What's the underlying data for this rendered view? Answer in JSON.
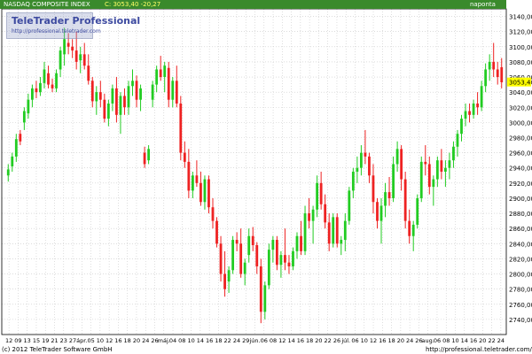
{
  "header": {
    "title": "NASDAQ COMPOSITE INDEX",
    "quote": "C: 3053,40 -20,27",
    "period": "napontа"
  },
  "watermark": {
    "title": "TeleTrader Professional",
    "url": "http://professional.teletrader.com"
  },
  "footer": {
    "copyright": "(c) 2012 TeleTrader Software GmbH",
    "url": "http://professional.teletrader.com/"
  },
  "colors": {
    "up": "#22cc22",
    "down": "#ee2222",
    "grid": "#c8c8c8",
    "header_bg": "#3a8a2c",
    "last_price_bg": "#ffff00"
  },
  "chart_data": {
    "type": "candlestick",
    "title": "NASDAQ COMPOSITE INDEX",
    "last_price": "3053,40",
    "change": "-20,27",
    "ylim": [
      2720,
      3150
    ],
    "y_ticks": [
      "2740,00",
      "2760,00",
      "2780,00",
      "2800,00",
      "2820,00",
      "2840,00",
      "2860,00",
      "2880,00",
      "2900,00",
      "2920,00",
      "2940,00",
      "2960,00",
      "2980,00",
      "3000,00",
      "3020,00",
      "3040,00",
      "3060,00",
      "3080,00",
      "3100,00",
      "3120,00",
      "3140,00"
    ],
    "x_ticks": [
      "12",
      "09",
      "13",
      "15",
      "19",
      "21",
      "23",
      "27",
      "ápr.",
      "05",
      "10",
      "12",
      "16",
      "18",
      "20",
      "24",
      "26",
      "máj.",
      "04",
      "08",
      "10",
      "14",
      "16",
      "18",
      "22",
      "24",
      "29",
      "jún.",
      "06",
      "08",
      "12",
      "14",
      "16",
      "18",
      "20",
      "22",
      "26",
      "júl.",
      "06",
      "10",
      "12",
      "16",
      "18",
      "20",
      "24",
      "26",
      "aug.",
      "06",
      "08",
      "10",
      "14",
      "16",
      "20",
      "22",
      "24"
    ],
    "candles": [
      [
        2930,
        2945,
        2922,
        2938
      ],
      [
        2942,
        2960,
        2935,
        2955
      ],
      [
        2955,
        2985,
        2948,
        2978
      ],
      [
        2985,
        2990,
        2970,
        2975
      ],
      [
        3000,
        3020,
        2990,
        3015
      ],
      [
        3012,
        3038,
        3005,
        3030
      ],
      [
        3030,
        3050,
        3020,
        3045
      ],
      [
        3045,
        3055,
        3032,
        3040
      ],
      [
        3040,
        3060,
        3035,
        3052
      ],
      [
        3052,
        3080,
        3045,
        3070
      ],
      [
        3065,
        3075,
        3045,
        3050
      ],
      [
        3050,
        3058,
        3040,
        3045
      ],
      [
        3045,
        3070,
        3040,
        3065
      ],
      [
        3070,
        3100,
        3060,
        3095
      ],
      [
        3090,
        3125,
        3075,
        3110
      ],
      [
        3105,
        3118,
        3090,
        3100
      ],
      [
        3100,
        3110,
        3085,
        3095
      ],
      [
        3095,
        3120,
        3070,
        3080
      ],
      [
        3082,
        3100,
        3065,
        3090
      ],
      [
        3090,
        3105,
        3070,
        3075
      ],
      [
        3075,
        3090,
        3050,
        3055
      ],
      [
        3055,
        3060,
        3020,
        3028
      ],
      [
        3028,
        3048,
        3010,
        3040
      ],
      [
        3040,
        3055,
        3020,
        3030
      ],
      [
        3030,
        3038,
        3000,
        3005
      ],
      [
        3005,
        3030,
        2995,
        3025
      ],
      [
        3025,
        3050,
        3015,
        3045
      ],
      [
        3045,
        3060,
        3000,
        3010
      ],
      [
        3010,
        3040,
        2985,
        3035
      ],
      [
        3035,
        3045,
        3010,
        3020
      ],
      [
        3020,
        3055,
        3010,
        3048
      ],
      [
        3048,
        3070,
        3035,
        3055
      ],
      [
        3055,
        3062,
        3020,
        3030
      ],
      [
        3030,
        3050,
        3015,
        3045
      ],
      [
        2960,
        2968,
        2940,
        2945
      ],
      [
        2950,
        2970,
        2945,
        2965
      ],
      [
        3030,
        3055,
        3020,
        3050
      ],
      [
        3050,
        3075,
        3040,
        3070
      ],
      [
        3070,
        3088,
        3055,
        3060
      ],
      [
        3060,
        3080,
        3040,
        3075
      ],
      [
        3072,
        3080,
        3020,
        3030
      ],
      [
        3030,
        3060,
        3020,
        3055
      ],
      [
        3055,
        3075,
        3020,
        3025
      ],
      [
        3025,
        3035,
        2950,
        2960
      ],
      [
        2960,
        2975,
        2940,
        2948
      ],
      [
        2948,
        2965,
        2900,
        2910
      ],
      [
        2910,
        2935,
        2900,
        2930
      ],
      [
        2930,
        2950,
        2915,
        2920
      ],
      [
        2920,
        2935,
        2890,
        2895
      ],
      [
        2895,
        2930,
        2885,
        2925
      ],
      [
        2925,
        2930,
        2880,
        2888
      ],
      [
        2888,
        2900,
        2860,
        2870
      ],
      [
        2870,
        2875,
        2835,
        2840
      ],
      [
        2840,
        2850,
        2790,
        2800
      ],
      [
        2800,
        2830,
        2770,
        2780
      ],
      [
        2790,
        2810,
        2775,
        2805
      ],
      [
        2805,
        2850,
        2800,
        2845
      ],
      [
        2845,
        2855,
        2830,
        2840
      ],
      [
        2840,
        2860,
        2795,
        2800
      ],
      [
        2800,
        2820,
        2785,
        2815
      ],
      [
        2825,
        2860,
        2815,
        2850
      ],
      [
        2850,
        2862,
        2830,
        2838
      ],
      [
        2838,
        2842,
        2800,
        2810
      ],
      [
        2810,
        2820,
        2735,
        2750
      ],
      [
        2750,
        2790,
        2740,
        2785
      ],
      [
        2785,
        2840,
        2780,
        2832
      ],
      [
        2832,
        2850,
        2815,
        2845
      ],
      [
        2845,
        2850,
        2805,
        2812
      ],
      [
        2812,
        2830,
        2795,
        2825
      ],
      [
        2825,
        2860,
        2805,
        2815
      ],
      [
        2815,
        2825,
        2800,
        2810
      ],
      [
        2810,
        2835,
        2805,
        2830
      ],
      [
        2830,
        2855,
        2820,
        2850
      ],
      [
        2850,
        2870,
        2825,
        2830
      ],
      [
        2830,
        2890,
        2825,
        2880
      ],
      [
        2880,
        2900,
        2860,
        2870
      ],
      [
        2870,
        2890,
        2840,
        2885
      ],
      [
        2885,
        2930,
        2875,
        2920
      ],
      [
        2920,
        2935,
        2885,
        2892
      ],
      [
        2892,
        2905,
        2860,
        2868
      ],
      [
        2868,
        2880,
        2830,
        2840
      ],
      [
        2840,
        2880,
        2835,
        2875
      ],
      [
        2875,
        2880,
        2835,
        2840
      ],
      [
        2840,
        2850,
        2825,
        2845
      ],
      [
        2845,
        2880,
        2830,
        2870
      ],
      [
        2870,
        2915,
        2865,
        2910
      ],
      [
        2910,
        2940,
        2900,
        2935
      ],
      [
        2935,
        2955,
        2920,
        2940
      ],
      [
        2940,
        2970,
        2930,
        2960
      ],
      [
        2960,
        2990,
        2945,
        2955
      ],
      [
        2955,
        2960,
        2920,
        2930
      ],
      [
        2930,
        2945,
        2880,
        2895
      ],
      [
        2895,
        2900,
        2860,
        2870
      ],
      [
        2870,
        2900,
        2840,
        2890
      ],
      [
        2890,
        2920,
        2875,
        2908
      ],
      [
        2908,
        2928,
        2890,
        2900
      ],
      [
        2900,
        2955,
        2895,
        2945
      ],
      [
        2945,
        2975,
        2935,
        2965
      ],
      [
        2965,
        2970,
        2910,
        2925
      ],
      [
        2925,
        2935,
        2860,
        2870
      ],
      [
        2870,
        2885,
        2840,
        2850
      ],
      [
        2850,
        2870,
        2830,
        2865
      ],
      [
        2865,
        2905,
        2860,
        2900
      ],
      [
        2900,
        2955,
        2895,
        2948
      ],
      [
        2948,
        2970,
        2930,
        2945
      ],
      [
        2945,
        2955,
        2905,
        2915
      ],
      [
        2915,
        2930,
        2890,
        2925
      ],
      [
        2925,
        2955,
        2915,
        2950
      ],
      [
        2950,
        2965,
        2925,
        2935
      ],
      [
        2935,
        2950,
        2915,
        2940
      ],
      [
        2940,
        2960,
        2925,
        2950
      ],
      [
        2950,
        2975,
        2940,
        2968
      ],
      [
        2968,
        2990,
        2955,
        2985
      ],
      [
        2985,
        3010,
        2975,
        3005
      ],
      [
        3005,
        3025,
        2995,
        3015
      ],
      [
        3015,
        3025,
        3000,
        3010
      ],
      [
        3010,
        3030,
        3005,
        3025
      ],
      [
        3025,
        3040,
        3010,
        3020
      ],
      [
        3020,
        3055,
        3015,
        3048
      ],
      [
        3048,
        3078,
        3040,
        3070
      ],
      [
        3070,
        3090,
        3055,
        3080
      ],
      [
        3080,
        3105,
        3060,
        3070
      ],
      [
        3070,
        3080,
        3050,
        3060
      ],
      [
        3073,
        3085,
        3045,
        3053
      ]
    ]
  }
}
